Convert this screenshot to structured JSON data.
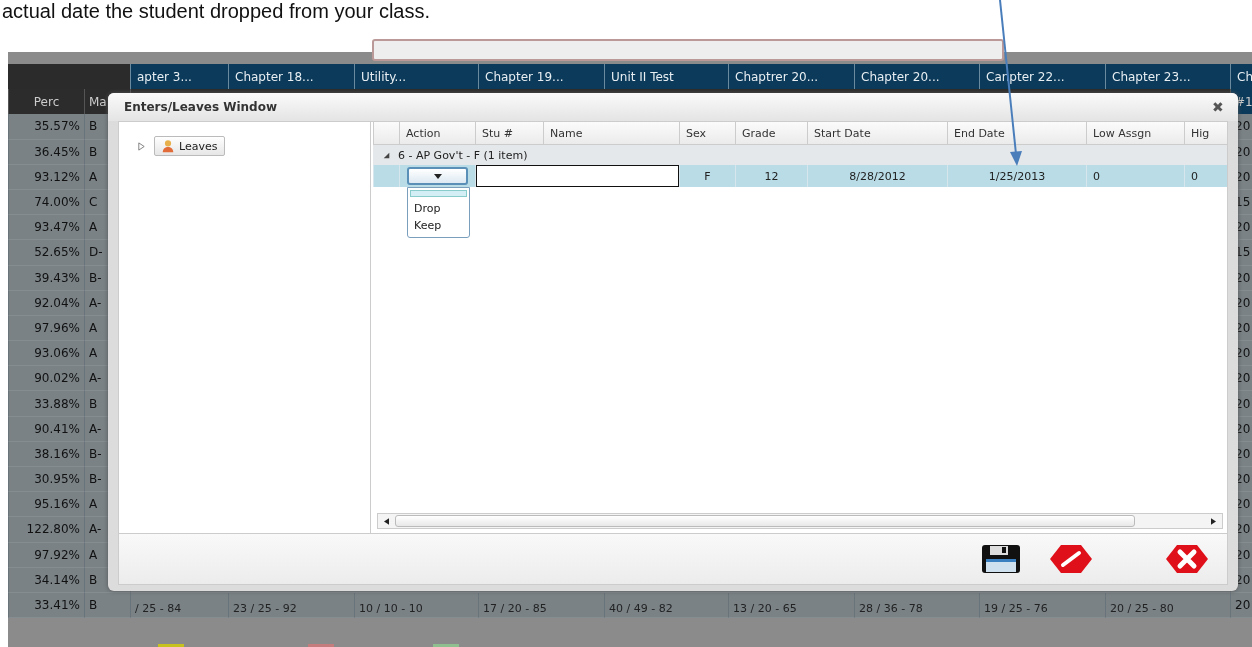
{
  "instruction_text": "actual date the student dropped from your class.",
  "gradebook": {
    "header_columns": [
      "apter 3...",
      "Chapter 18...",
      "Utility...",
      "Chapter 19...",
      "Unit II Test",
      "Chaptrer 20...",
      "Chapter 20...",
      "Canpter 22...",
      "Chapter 23...",
      "Ch"
    ],
    "subheader": {
      "perc": "Perc",
      "mark": "Ma",
      "last": "#1"
    },
    "rows": [
      {
        "perc": "35.57%",
        "mark": "B",
        "last": "20"
      },
      {
        "perc": "36.45%",
        "mark": "B",
        "last": "20"
      },
      {
        "perc": "93.12%",
        "mark": "A",
        "last": "20"
      },
      {
        "perc": "74.00%",
        "mark": "C",
        "last": "15"
      },
      {
        "perc": "93.47%",
        "mark": "A",
        "last": "20"
      },
      {
        "perc": "52.65%",
        "mark": "D-",
        "last": "15"
      },
      {
        "perc": "39.43%",
        "mark": "B-",
        "last": "20"
      },
      {
        "perc": "92.04%",
        "mark": "A-",
        "last": "20"
      },
      {
        "perc": "97.96%",
        "mark": "A",
        "last": "20"
      },
      {
        "perc": "93.06%",
        "mark": "A",
        "last": "20"
      },
      {
        "perc": "90.02%",
        "mark": "A-",
        "last": "20"
      },
      {
        "perc": "33.88%",
        "mark": "B",
        "last": "20"
      },
      {
        "perc": "90.41%",
        "mark": "A-",
        "last": "20"
      },
      {
        "perc": "38.16%",
        "mark": "B-",
        "last": "20"
      },
      {
        "perc": "30.95%",
        "mark": "B-",
        "last": "20"
      },
      {
        "perc": "95.16%",
        "mark": "A",
        "last": "20"
      },
      {
        "perc": "122.80%",
        "mark": "A-",
        "last": "20"
      },
      {
        "perc": "97.92%",
        "mark": "A",
        "last": "20"
      },
      {
        "perc": "34.14%",
        "mark": "B",
        "last": "20"
      },
      {
        "perc": "33.41%",
        "mark": "B",
        "last": "20"
      }
    ],
    "last_row_scores": [
      "/ 25 - 84",
      "23 / 25 - 92",
      "10 / 10 - 10",
      "17 / 20 - 85",
      "40 / 49 - 82",
      "13 / 20 - 65",
      "28 / 36 - 78",
      "19 / 25 - 76",
      "20 / 25 - 80"
    ],
    "legend": [
      {
        "color": "#c8c21e"
      },
      {
        "color": "#c47c7c"
      },
      {
        "color": "#8fbf8f"
      }
    ]
  },
  "dialog": {
    "title": "Enters/Leaves Window",
    "close": "✖",
    "tree": [
      {
        "label": "Leaves",
        "expanded": false
      }
    ],
    "grid": {
      "columns": [
        "Action",
        "Stu #",
        "Name",
        "Sex",
        "Grade",
        "Start Date",
        "End Date",
        "Low Assgn",
        "Hig"
      ],
      "group": {
        "label": "6 - AP Gov't - F (1 item)",
        "expanded": true
      },
      "rows": [
        {
          "selected": true,
          "sex": "F",
          "grade": "12",
          "start_date": "8/28/2012",
          "end_date": "1/25/2013",
          "low_assgn": "0",
          "high": "0"
        }
      ],
      "blank_option": {
        "selected": true
      },
      "action_options": [
        {
          "label": "Drop",
          "selected": false
        },
        {
          "label": "Keep",
          "selected": false
        }
      ]
    },
    "footer_buttons": [
      {
        "kind": "save"
      },
      {
        "kind": "clear"
      },
      {
        "kind": "cancel"
      }
    ]
  }
}
